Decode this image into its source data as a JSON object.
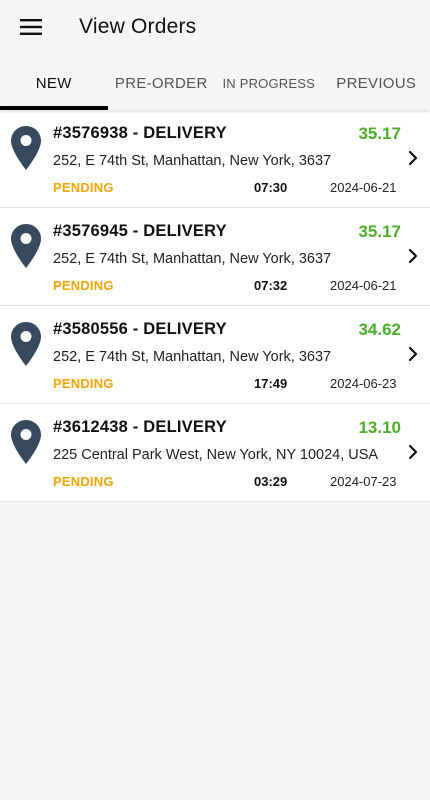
{
  "header": {
    "title": "View Orders",
    "menu_icon": "hamburger-menu-icon"
  },
  "tabs": [
    {
      "label": "NEW",
      "active": true
    },
    {
      "label": "PRE-ORDER",
      "active": false
    },
    {
      "label": "IN PROGRESS",
      "active": false
    },
    {
      "label": "PREVIOUS",
      "active": false
    }
  ],
  "orders": [
    {
      "title": "#3576938 - DELIVERY",
      "amount": "35.17",
      "address": "252, E 74th St, Manhattan, New York, 3637",
      "status": "PENDING",
      "time": "07:30",
      "date": "2024-06-21"
    },
    {
      "title": "#3576945 - DELIVERY",
      "amount": "35.17",
      "address": "252, E 74th St, Manhattan, New York, 3637",
      "status": "PENDING",
      "time": "07:32",
      "date": "2024-06-21"
    },
    {
      "title": "#3580556 - DELIVERY",
      "amount": "34.62",
      "address": "252, E 74th St, Manhattan, New York, 3637",
      "status": "PENDING",
      "time": "17:49",
      "date": "2024-06-23"
    },
    {
      "title": "#3612438 - DELIVERY",
      "amount": "13.10",
      "address": "225 Central Park West, New York, NY 10024, USA",
      "status": "PENDING",
      "time": "03:29",
      "date": "2024-07-23"
    }
  ],
  "colors": {
    "amount": "#4caf2a",
    "status_pending": "#f7a400",
    "pin": "#37495c",
    "active_tab_indicator": "#000000"
  },
  "icons": {
    "location": "location-pin-icon",
    "row_action": "chevron-right-icon"
  }
}
